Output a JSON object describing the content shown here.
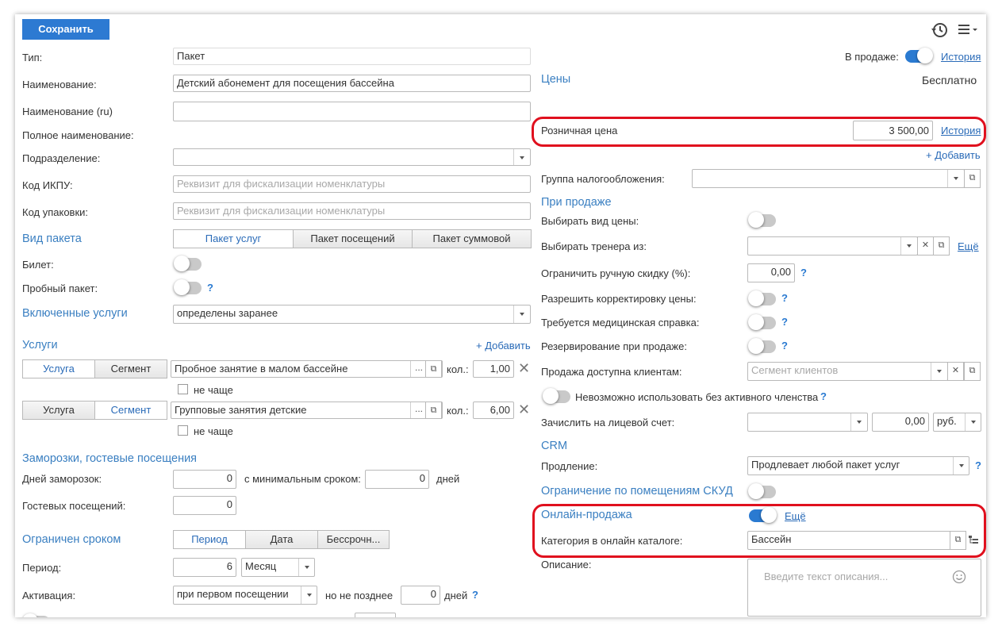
{
  "toolbar": {
    "save_label": "Сохранить",
    "history_icon": "history-icon",
    "menu_icon": "menu-icon"
  },
  "left": {
    "type_label": "Тип:",
    "type_value": "Пакет",
    "name_label": "Наименование:",
    "name_value": "Детский абонемент для посещения бассейна",
    "name_ru_label": "Наименование (ru)",
    "fullname_label": "Полное наименование:",
    "division_label": "Подразделение:",
    "ikpu_label": "Код ИКПУ:",
    "ikpu_placeholder": "Реквизит для фискализации номенклатуры",
    "pack_label": "Код упаковки:",
    "pack_placeholder": "Реквизит для фискализации номенклатуры",
    "package_kind_section": "Вид пакета",
    "package_kind_options": [
      "Пакет услуг",
      "Пакет посещений",
      "Пакет суммовой"
    ],
    "ticket_label": "Билет:",
    "trial_label": "Пробный пакет:",
    "included_section": "Включенные услуги",
    "included_value": "определены заранее",
    "services_section": "Услуги",
    "add_label": "+ Добавить",
    "services": [
      {
        "mode_options": [
          "Услуга",
          "Сегмент"
        ],
        "name": "Пробное занятие в малом бассейне",
        "qty_label": "кол.:",
        "qty": "1,00",
        "limit_label": "не чаще"
      },
      {
        "mode_options": [
          "Услуга",
          "Сегмент"
        ],
        "name": "Групповые занятия детские",
        "qty_label": "кол.:",
        "qty": "6,00",
        "limit_label": "не чаще"
      }
    ],
    "freeze_section": "Заморозки, гостевые посещения",
    "freeze_days_label": "Дней заморозок:",
    "freeze_days": "0",
    "min_term_label": "с минимальным сроком:",
    "min_term": "0",
    "days_label": "дней",
    "guest_label": "Гостевых посещений:",
    "guest_value": "0",
    "limited_section": "Ограничен сроком",
    "limited_options": [
      "Период",
      "Дата",
      "Бессрочн..."
    ],
    "period_label": "Период:",
    "period_value": "6",
    "period_unit": "Месяц",
    "activation_label": "Активация:",
    "activation_value": "при первом посещении",
    "not_later_label": "но не позднее",
    "not_later_value": "0",
    "not_later_days": "дней"
  },
  "right": {
    "on_sale_label": "В продаже:",
    "history_link": "История",
    "prices_section": "Цены",
    "free_label": "Бесплатно",
    "retail_label": "Розничная цена",
    "retail_value": "3 500,00",
    "retail_history": "История",
    "add_label": "+ Добавить",
    "tax_label": "Группа налогообложения:",
    "on_sale_section": "При продаже",
    "choose_price_label": "Выбирать вид цены:",
    "choose_trainer_label": "Выбирать тренера из:",
    "more_link": "Ещё",
    "manual_discount_label": "Ограничить ручную скидку (%):",
    "manual_discount_value": "0,00",
    "price_adjust_label": "Разрешить корректировку цены:",
    "med_cert_label": "Требуется медицинская справка:",
    "reserve_label": "Резервирование при продаже:",
    "clients_label": "Продажа доступна клиентам:",
    "clients_placeholder": "Сегмент клиентов",
    "membership_label": "Невозможно использовать без активного членства",
    "account_label": "Зачислить на лицевой счет:",
    "account_amount": "0,00",
    "account_currency": "руб.",
    "crm_section": "CRM",
    "renewal_label": "Продление:",
    "renewal_value": "Продлевает любой пакет услуг",
    "skud_section": "Ограничение по помещениям СКУД",
    "online_section": "Онлайн-продажа",
    "online_more": "Ещё",
    "catalog_label": "Категория в онлайн каталоге:",
    "catalog_value": "Бассейн",
    "description_label": "Описание:",
    "description_placeholder": "Введите текст описания..."
  },
  "colors": {
    "accent": "#2d7ad2",
    "section": "#3a7fc1",
    "highlight": "#e0101e"
  }
}
